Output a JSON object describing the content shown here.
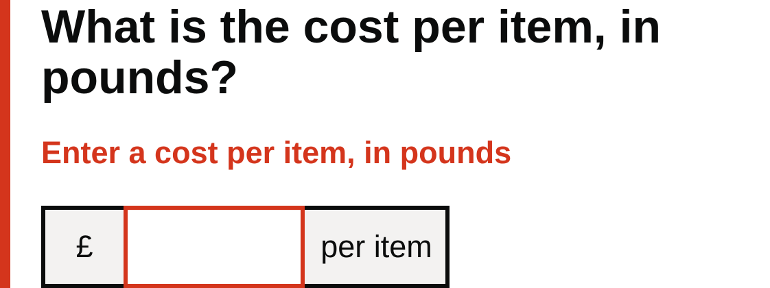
{
  "question": {
    "heading": "What is the cost per item, in pounds?"
  },
  "error": {
    "message": "Enter a cost per item, in pounds"
  },
  "cost_input": {
    "prefix": "£",
    "value": "",
    "placeholder": "",
    "suffix": "per item"
  },
  "colors": {
    "error": "#d4351c",
    "text": "#0b0c0c",
    "affix_background": "#f3f2f1"
  }
}
